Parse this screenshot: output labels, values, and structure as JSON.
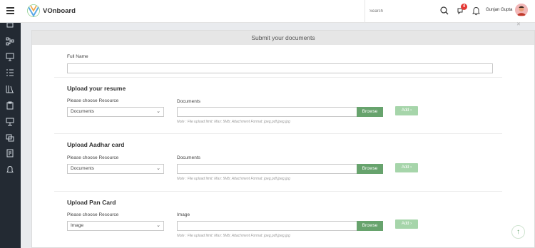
{
  "header": {
    "brand": "VOnboard",
    "search_placeholder": "Search",
    "notification_count": "4",
    "user_name": "Gunjan Gupta"
  },
  "sidebar": {
    "items": [
      "hierarchy-icon",
      "monitor-icon",
      "list-icon",
      "library-icon",
      "clipboard-icon",
      "presentation-icon",
      "cards-icon",
      "report-icon",
      "bell-icon"
    ]
  },
  "page": {
    "title": "Submit your documents",
    "full_name_label": "Full Name",
    "full_name_value": ""
  },
  "sections": [
    {
      "title": "Upload your resume",
      "resource_label": "Please choose Resource",
      "resource_value": "Documents",
      "file_label": "Documents",
      "browse_label": "Browse",
      "add_label": "Add",
      "note": "Note : File upload limit: Max: 5Mb; Attachment Format: jpeg,pdf,jpeg,jpg"
    },
    {
      "title": "Upload Aadhar card",
      "resource_label": "Please choose Resource",
      "resource_value": "Documents",
      "file_label": "Documents",
      "browse_label": "Browse",
      "add_label": "Add",
      "note": "Note : File upload limit: Max: 5Mb; Attachment Format: jpeg,pdf,jpeg,jpg"
    },
    {
      "title": "Upload Pan Card",
      "resource_label": "Please choose Resource",
      "resource_value": "Image",
      "file_label": "Image",
      "browse_label": "Browse",
      "add_label": "Add",
      "note": "Note : File upload limit: Max: 5Mb; Attachment Format: jpeg,pdf,jpeg,jpg"
    }
  ],
  "colors": {
    "sidebar_bg": "#232a33",
    "browse_bg": "#67a36d",
    "add_bg": "#a6d5aa",
    "badge_bg": "#e53935"
  }
}
